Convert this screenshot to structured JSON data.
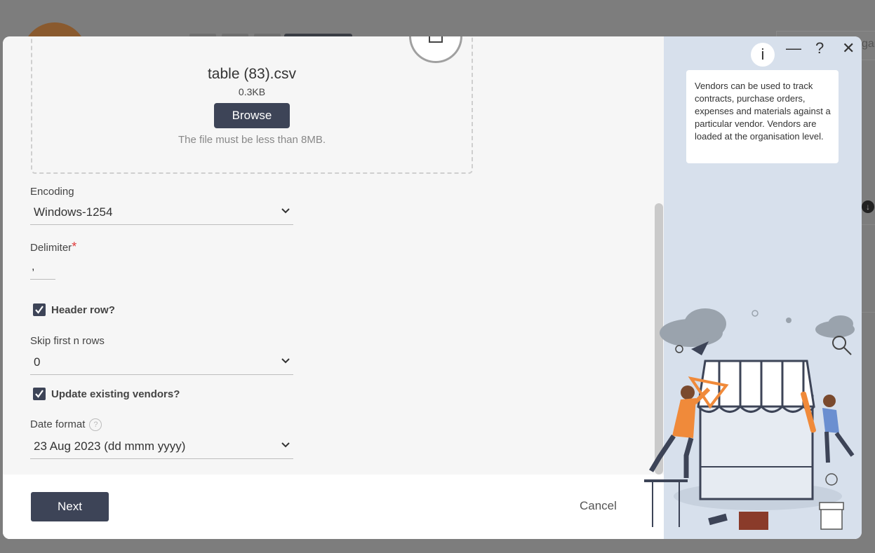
{
  "background": {
    "partial_text": "gan"
  },
  "dialog": {
    "upload": {
      "file_name": "table (83).csv",
      "file_size": "0.3KB",
      "browse_label": "Browse",
      "note": "The file must be less than 8MB."
    },
    "encoding": {
      "label": "Encoding",
      "value": "Windows-1254"
    },
    "delimiter": {
      "label": "Delimiter",
      "required_mark": "*",
      "value": ","
    },
    "header_row": {
      "label": "Header row?",
      "checked": true
    },
    "skip_rows": {
      "label": "Skip first n rows",
      "value": "0"
    },
    "update_vendors": {
      "label": "Update existing vendors?",
      "checked": true
    },
    "date_format": {
      "label": "Date format",
      "help": "?",
      "value": "23 Aug 2023 (dd mmm yyyy)"
    },
    "footer": {
      "next_label": "Next",
      "cancel_label": "Cancel"
    },
    "window_controls": {
      "minimize": "—",
      "help": "?",
      "close": "✕"
    },
    "info": {
      "badge": "i",
      "text": "Vendors can be used to track contracts, purchase orders, expenses and materials against a particular vendor. Vendors are loaded at the organisation level."
    },
    "icons": {
      "upload": "upload-icon",
      "chevron": "chevron-down-icon",
      "check": "check-icon"
    },
    "colors": {
      "primary": "#3d4457",
      "panel_bg": "#d7e0ec",
      "required": "#e03a3a",
      "accent": "#f08a3a"
    }
  }
}
